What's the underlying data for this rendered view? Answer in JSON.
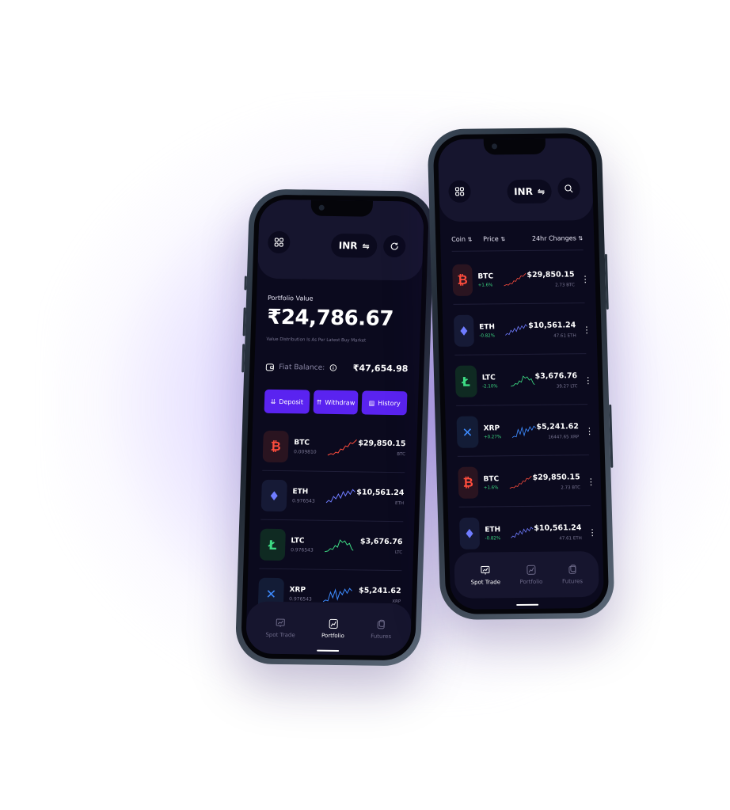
{
  "left_phone": {
    "currency_label": "INR",
    "portfolio_title": "Portfolio Value",
    "portfolio_value": "₹24,786.67",
    "portfolio_note": "Value Distribution Is As Per Latest Buy Market",
    "fiat_label": "Fiat Balance:",
    "fiat_value": "₹47,654.98",
    "actions": [
      "Deposit",
      "Withdraw",
      "History"
    ],
    "coins": [
      {
        "symbol": "BTC",
        "qty": "0.009810",
        "value": "$29,850.15",
        "unit": "BTC",
        "icon": "bitcoin-icon",
        "color": "#ff4d3d",
        "bg": "#2a1420"
      },
      {
        "symbol": "ETH",
        "qty": "0.976543",
        "value": "$10,561.24",
        "unit": "ETH",
        "icon": "ethereum-icon",
        "color": "#6f7cff",
        "bg": "#161a36"
      },
      {
        "symbol": "LTC",
        "qty": "0.976543",
        "value": "$3,676.76",
        "unit": "LTC",
        "icon": "litecoin-icon",
        "color": "#3ddc84",
        "bg": "#0f2a22"
      },
      {
        "symbol": "XRP",
        "qty": "0.976543",
        "value": "$5,241.62",
        "unit": "XRP",
        "icon": "xrp-icon",
        "color": "#3d8bff",
        "bg": "#131c36"
      }
    ],
    "tabs": [
      "Spot Trade",
      "Portfolio",
      "Futures"
    ]
  },
  "right_phone": {
    "currency_label": "INR",
    "headers": [
      "Coin",
      "Price",
      "24hr Changes"
    ],
    "coins": [
      {
        "symbol": "BTC",
        "change": "+1.6%",
        "value": "$29,850.15",
        "unit": "2.73 BTC",
        "icon": "bitcoin-icon",
        "color": "#ff4d3d",
        "bg": "#2a1420"
      },
      {
        "symbol": "ETH",
        "change": "-0.82%",
        "value": "$10,561.24",
        "unit": "47.61 ETH",
        "icon": "ethereum-icon",
        "color": "#6f7cff",
        "bg": "#161a36"
      },
      {
        "symbol": "LTC",
        "change": "-2.10%",
        "value": "$3,676.76",
        "unit": "39.27 LTC",
        "icon": "litecoin-icon",
        "color": "#3ddc84",
        "bg": "#0f2a22"
      },
      {
        "symbol": "XRP",
        "change": "+0.27%",
        "value": "$5,241.62",
        "unit": "16447.65 XRP",
        "icon": "xrp-icon",
        "color": "#3d8bff",
        "bg": "#131c36"
      },
      {
        "symbol": "BTC",
        "change": "+1.6%",
        "value": "$29,850.15",
        "unit": "2.73 BTC",
        "icon": "bitcoin-icon",
        "color": "#ff4d3d",
        "bg": "#2a1420"
      },
      {
        "symbol": "ETH",
        "change": "-0.82%",
        "value": "$10,561.24",
        "unit": "47.61 ETH",
        "icon": "ethereum-icon",
        "color": "#6f7cff",
        "bg": "#161a36"
      }
    ],
    "tabs": [
      "Spot Trade",
      "Portfolio",
      "Futures"
    ]
  },
  "colors": {
    "accent": "#5a23f0",
    "background": "#0b0a1e",
    "positive": "#3ddc84"
  }
}
